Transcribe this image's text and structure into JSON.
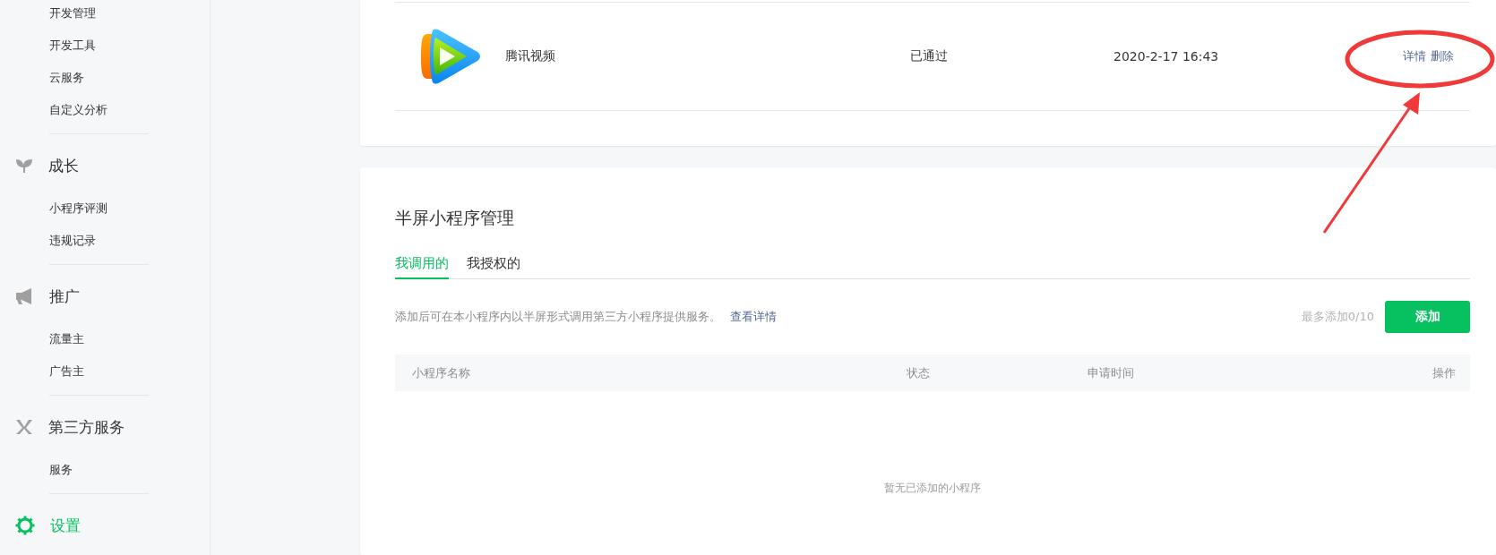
{
  "sidebar": {
    "groups": [
      {
        "items": [
          "开发管理",
          "开发工具",
          "云服务",
          "自定义分析"
        ]
      },
      {
        "title": "成长",
        "selected": false,
        "items": [
          "小程序评测",
          "违规记录"
        ]
      },
      {
        "title": "推广",
        "selected": false,
        "items": [
          "流量主",
          "广告主"
        ]
      },
      {
        "title": "第三方服务",
        "selected": false,
        "items": [
          "服务"
        ]
      },
      {
        "title": "设置",
        "selected": true
      }
    ]
  },
  "plugin_table": {
    "rows": [
      {
        "name": "腾讯视频",
        "status": "已通过",
        "time": "2020-2-17 16:43",
        "actions": [
          "详情",
          "删除"
        ]
      }
    ]
  },
  "half_screen": {
    "title": "半屏小程序管理",
    "tabs": [
      {
        "label": "我调用的",
        "selected": true
      },
      {
        "label": "我授权的",
        "selected": false
      }
    ],
    "description": "添加后可在本小程序内以半屏形式调用第三方小程序提供服务。",
    "details_link": "查看详情",
    "limit": "最多添加0/10",
    "add_button": "添加",
    "columns": [
      "小程序名称",
      "状态",
      "申请时间",
      "操作"
    ],
    "empty_text": "暂无已添加的小程序"
  }
}
